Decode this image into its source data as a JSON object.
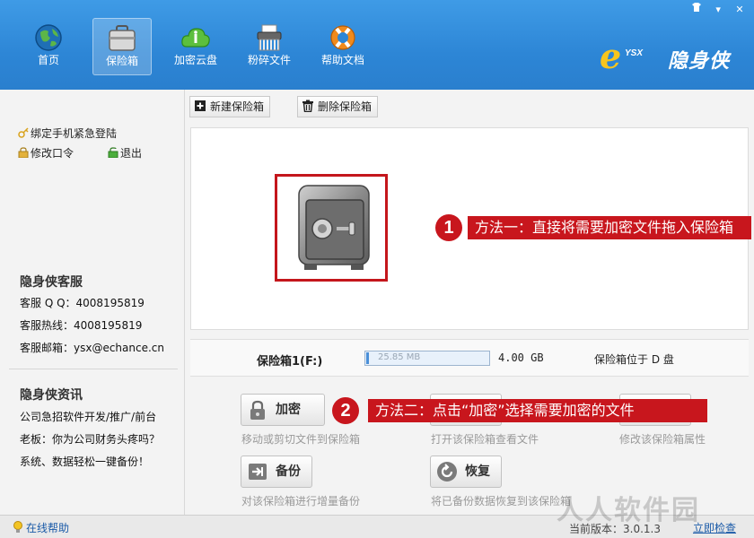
{
  "window": {
    "skin_icon": "skin-icon",
    "min_label": "▾",
    "close_label": "✕"
  },
  "nav": [
    {
      "label": "首页",
      "icon": "globe-icon"
    },
    {
      "label": "保险箱",
      "icon": "safe-icon"
    },
    {
      "label": "加密云盘",
      "icon": "cloud-icon"
    },
    {
      "label": "粉碎文件",
      "icon": "shredder-icon"
    },
    {
      "label": "帮助文档",
      "icon": "lifebuoy-icon"
    }
  ],
  "brand": {
    "e": "e",
    "tag": "YSX",
    "name": "隐身侠"
  },
  "sidebar": {
    "bind_phone": "绑定手机紧急登陆",
    "change_password": "修改口令",
    "logout": "退出",
    "service_title": "隐身侠客服",
    "service_qq": "客服 Q Q：4008195819",
    "service_hotline": "客服热线：4008195819",
    "service_email": "客服邮箱：ysx@echance.cn",
    "news_title": "隐身侠资讯",
    "news": [
      "公司急招软件开发/推广/前台",
      "老板：你为公司财务头疼吗？",
      "系统、数据轻松一键备份！"
    ]
  },
  "toolbar": {
    "new_vault": "新建保险箱",
    "delete_vault": "删除保险箱"
  },
  "hints": {
    "one_num": "1",
    "one_text": "方法一：直接将需要加密文件拖入保险箱",
    "two_num": "2",
    "two_text": "方法二：点击“加密”选择需要加密的文件"
  },
  "vault": {
    "name": "保险箱1(F:)",
    "used": "25.85 MB",
    "used_fraction": 0.006,
    "capacity": "4.00 GB",
    "location": "保险箱位于 D 盘"
  },
  "actions": {
    "encrypt_label": "加密",
    "encrypt_desc": "移动或剪切文件到保险箱",
    "open_desc": "打开该保险箱查看文件",
    "props_desc": "修改该保险箱属性",
    "backup_label": "备份",
    "backup_desc": "对该保险箱进行增量备份",
    "restore_label": "恢复",
    "restore_desc": "将已备份数据恢复到该保险箱"
  },
  "statusbar": {
    "help": "在线帮助",
    "version": "当前版本：3.0.1.3",
    "check_update": "立即检查"
  },
  "watermark": "人人软件园",
  "colors": {
    "header": "#2d86d6",
    "accent_red": "#c8161d",
    "link": "#1a5aa8"
  }
}
